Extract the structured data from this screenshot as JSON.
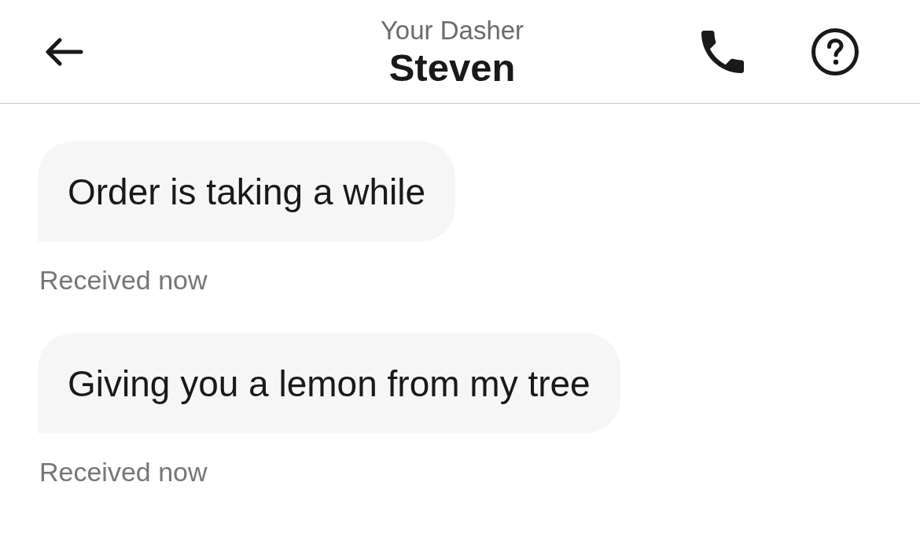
{
  "header": {
    "subtitle": "Your Dasher",
    "title": "Steven"
  },
  "messages": [
    {
      "text": "Order is taking a while",
      "status": "Received now"
    },
    {
      "text": "Giving you a lemon from my tree",
      "status": "Received now"
    }
  ]
}
